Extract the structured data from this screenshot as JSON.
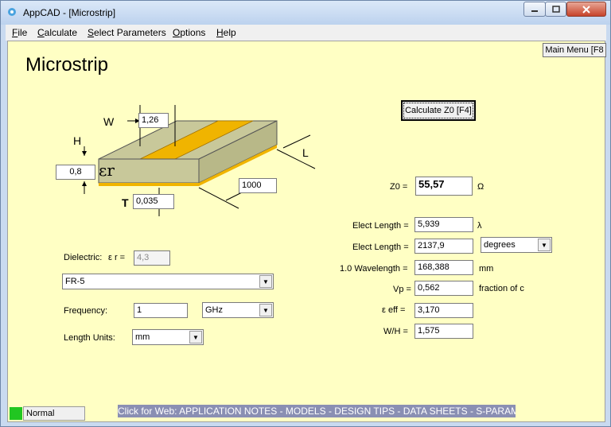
{
  "window": {
    "title": "AppCAD - [Microstrip]"
  },
  "menu": [
    {
      "label": "File",
      "key": "F",
      "rest": "ile"
    },
    {
      "label": "Calculate",
      "key": "C",
      "rest": "alculate"
    },
    {
      "label": "Select Parameters",
      "key": "S",
      "rest": "elect Parameters"
    },
    {
      "label": "Options",
      "key": "O",
      "rest": "ptions"
    },
    {
      "label": "Help",
      "key": "H",
      "rest": "elp"
    }
  ],
  "page": {
    "heading": "Microstrip",
    "main_menu_label": "Main Menu [F8"
  },
  "diagram": {
    "w_label": "W",
    "w_value": "1,26",
    "h_label": "H",
    "h_value": "0,8",
    "t_label": "T",
    "t_value": "0,035",
    "l_label": "L",
    "l_value": "1000",
    "er_symbol": "εr"
  },
  "inputs": {
    "dielectric_label": "Dielectric:",
    "er_label": "ε r =",
    "er_value": "4,3",
    "material": "FR-5",
    "frequency_label": "Frequency:",
    "frequency_value": "1",
    "frequency_unit": "GHz",
    "length_units_label": "Length Units:",
    "length_units_value": "mm"
  },
  "calc_button": "Calculate Z0  [F4]",
  "results": {
    "z0_label": "Z0 =",
    "z0_value": "55,57",
    "z0_unit": "Ω",
    "elen1_label": "Elect Length =",
    "elen1_value": "5,939",
    "elen1_unit": "λ",
    "elen2_label": "Elect Length =",
    "elen2_value": "2137,9",
    "elen2_unit": "degrees",
    "wavelength_label": "1.0 Wavelength =",
    "wavelength_value": "168,388",
    "wavelength_unit": "mm",
    "vp_label": "Vp =",
    "vp_value": "0,562",
    "vp_unit": "fraction of c",
    "eeff_label": "ε eff =",
    "eeff_value": "3,170",
    "wh_label": "W/H =",
    "wh_value": "1,575"
  },
  "status": {
    "mode": "Normal",
    "led_color": "#21c621",
    "web_link": "Click for Web: APPLICATION NOTES - MODELS - DESIGN TIPS - DATA SHEETS - S-PARAMETERS"
  },
  "colors": {
    "client_bg": "#ffffc4",
    "strip": "#f0b400",
    "substrate": "#c8c89a"
  }
}
